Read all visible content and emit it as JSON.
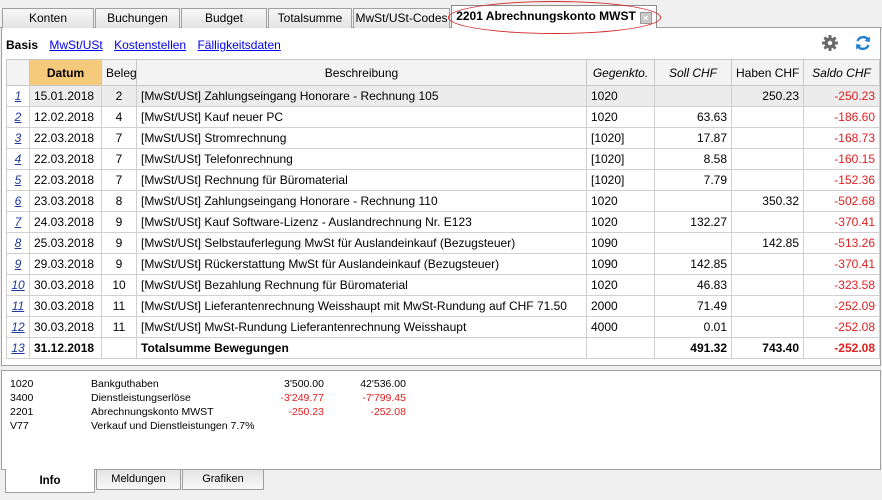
{
  "top_tabs": [
    {
      "label": "Konten"
    },
    {
      "label": "Buchungen"
    },
    {
      "label": "Budget"
    },
    {
      "label": "Totalsumme"
    },
    {
      "label": "MwSt/USt-Codes"
    },
    {
      "label": "2201 Abrechnungskonto MWST",
      "active": true
    }
  ],
  "close_glyph": "×",
  "view_tabs": {
    "basis": "Basis",
    "mwst": "MwSt/USt",
    "kostenstellen": "Kostenstellen",
    "faelligkeit": "Fälligkeitsdaten"
  },
  "icons": {
    "settings": "gear-icon",
    "refresh": "refresh-icon",
    "refresh_color": "#1e7fd0"
  },
  "columns": {
    "datum": "Datum",
    "beleg": "Beleg",
    "beschreibung": "Beschreibung",
    "gegenkto": "Gegenkto.",
    "soll": "Soll CHF",
    "haben": "Haben CHF",
    "saldo": "Saldo CHF"
  },
  "rows": [
    {
      "n": "1",
      "datum": "15.01.2018",
      "beleg": "2",
      "beschreibung": "[MwSt/USt] Zahlungseingang Honorare - Rechnung 105",
      "gegenkto": "1020",
      "soll": "",
      "haben": "250.23",
      "saldo": "-250.23"
    },
    {
      "n": "2",
      "datum": "12.02.2018",
      "beleg": "4",
      "beschreibung": "[MwSt/USt] Kauf neuer PC",
      "gegenkto": "1020",
      "soll": "63.63",
      "haben": "",
      "saldo": "-186.60"
    },
    {
      "n": "3",
      "datum": "22.03.2018",
      "beleg": "7",
      "beschreibung": "[MwSt/USt] Stromrechnung",
      "gegenkto": "[1020]",
      "soll": "17.87",
      "haben": "",
      "saldo": "-168.73"
    },
    {
      "n": "4",
      "datum": "22.03.2018",
      "beleg": "7",
      "beschreibung": "[MwSt/USt] Telefonrechnung",
      "gegenkto": "[1020]",
      "soll": "8.58",
      "haben": "",
      "saldo": "-160.15"
    },
    {
      "n": "5",
      "datum": "22.03.2018",
      "beleg": "7",
      "beschreibung": "[MwSt/USt] Rechnung für Büromaterial",
      "gegenkto": "[1020]",
      "soll": "7.79",
      "haben": "",
      "saldo": "-152.36"
    },
    {
      "n": "6",
      "datum": "23.03.2018",
      "beleg": "8",
      "beschreibung": "[MwSt/USt] Zahlungseingang Honorare - Rechnung 110",
      "gegenkto": "1020",
      "soll": "",
      "haben": "350.32",
      "saldo": "-502.68"
    },
    {
      "n": "7",
      "datum": "24.03.2018",
      "beleg": "9",
      "beschreibung": "[MwSt/USt] Kauf Software-Lizenz - Auslandrechnung Nr. E123",
      "gegenkto": "1020",
      "soll": "132.27",
      "haben": "",
      "saldo": "-370.41"
    },
    {
      "n": "8",
      "datum": "25.03.2018",
      "beleg": "9",
      "beschreibung": "[MwSt/USt] Selbstauferlegung MwSt für Auslandeinkauf (Bezugsteuer)",
      "gegenkto": "1090",
      "soll": "",
      "haben": "142.85",
      "saldo": "-513.26"
    },
    {
      "n": "9",
      "datum": "29.03.2018",
      "beleg": "9",
      "beschreibung": "[MwSt/USt] Rückerstattung MwSt für Auslandeinkauf (Bezugsteuer)",
      "gegenkto": "1090",
      "soll": "142.85",
      "haben": "",
      "saldo": "-370.41"
    },
    {
      "n": "10",
      "datum": "30.03.2018",
      "beleg": "10",
      "beschreibung": "[MwSt/USt] Bezahlung Rechnung für Büromaterial",
      "gegenkto": "1020",
      "soll": "46.83",
      "haben": "",
      "saldo": "-323.58"
    },
    {
      "n": "11",
      "datum": "30.03.2018",
      "beleg": "11",
      "beschreibung": "[MwSt/USt] Lieferantenrechnung Weisshaupt mit MwSt-Rundung auf CHF 71.50",
      "gegenkto": "2000",
      "soll": "71.49",
      "haben": "",
      "saldo": "-252.09"
    },
    {
      "n": "12",
      "datum": "30.03.2018",
      "beleg": "11",
      "beschreibung": "[MwSt/USt] MwSt-Rundung Lieferantenrechnung Weisshaupt",
      "gegenkto": "4000",
      "soll": "0.01",
      "haben": "",
      "saldo": "-252.08"
    },
    {
      "n": "13",
      "datum": "31.12.2018",
      "beleg": "",
      "beschreibung": "Totalsumme Bewegungen",
      "gegenkto": "",
      "soll": "491.32",
      "haben": "743.40",
      "saldo": "-252.08",
      "total": true
    }
  ],
  "info_rows": [
    {
      "account": "1020",
      "name": "Bankguthaben",
      "v1": "3'500.00",
      "v2": "42'536.00"
    },
    {
      "account": "3400",
      "name": "Dienstleistungserlöse",
      "v1": "-3'249.77",
      "v2": "-7'799.45"
    },
    {
      "account": "2201",
      "name": "Abrechnungskonto MWST",
      "v1": "-250.23",
      "v2": "-252.08"
    },
    {
      "account": "V77",
      "name": "Verkauf und Dienstleistungen 7.7%",
      "v1": "",
      "v2": ""
    }
  ],
  "bottom_tabs": [
    {
      "label": "Info",
      "active": true
    },
    {
      "label": "Meldungen"
    },
    {
      "label": "Grafiken"
    }
  ],
  "colors": {
    "negative": "#e02020",
    "date_header": "#f6ca7b",
    "highlight_ellipse": "#d42a2a",
    "link": "#0000ee"
  }
}
